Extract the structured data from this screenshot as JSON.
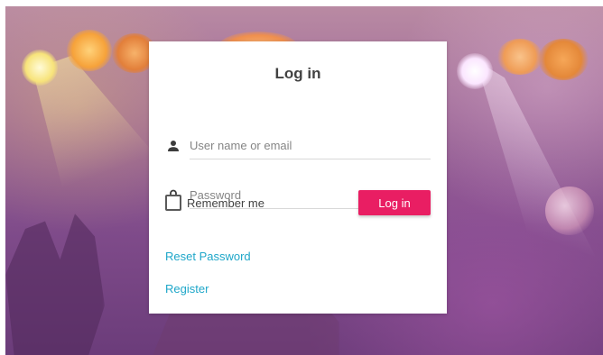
{
  "login_card": {
    "title": "Log in",
    "username_placeholder": "User name or email",
    "password_placeholder": "Password",
    "remember_label": "Remember me",
    "remember_checked": false,
    "submit_label": "Log in",
    "reset_password_link": "Reset Password",
    "register_link": "Register"
  },
  "icons": {
    "username": "user-icon",
    "password": "lock-icon"
  },
  "colors": {
    "primary_button": "#e91e63",
    "link": "#1fa7c9",
    "title_text": "#424242"
  }
}
